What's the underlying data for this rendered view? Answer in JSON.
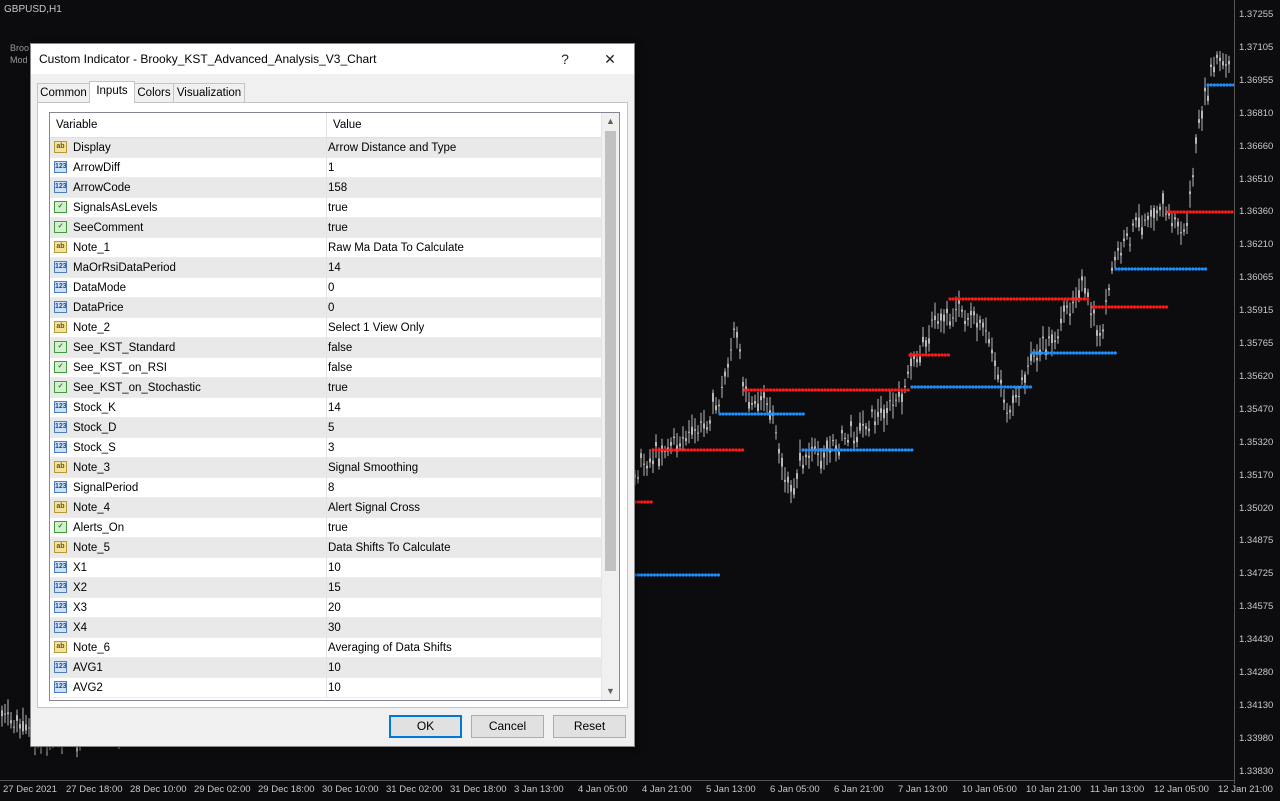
{
  "chart": {
    "title": "GBPUSD,H1",
    "side_lines": [
      "Broo",
      "Mod"
    ],
    "price_labels": [
      "1.37255",
      "1.37105",
      "1.36955",
      "1.36810",
      "1.36660",
      "1.36510",
      "1.36360",
      "1.36210",
      "1.36065",
      "1.35915",
      "1.35765",
      "1.35620",
      "1.35470",
      "1.35320",
      "1.35170",
      "1.35020",
      "1.34875",
      "1.34725",
      "1.34575",
      "1.34430",
      "1.34280",
      "1.34130",
      "1.33980",
      "1.33830"
    ],
    "time_labels": [
      "27 Dec 2021",
      "27 Dec 18:00",
      "28 Dec 10:00",
      "29 Dec 02:00",
      "29 Dec 18:00",
      "30 Dec 10:00",
      "31 Dec 02:00",
      "31 Dec 18:00",
      "3 Jan 13:00",
      "4 Jan 05:00",
      "4 Jan 21:00",
      "5 Jan 13:00",
      "6 Jan 05:00",
      "6 Jan 21:00",
      "7 Jan 13:00",
      "10 Jan 05:00",
      "10 Jan 21:00",
      "11 Jan 13:00",
      "12 Jan 05:00",
      "12 Jan 21:00"
    ],
    "colors": {
      "background": "#0c0c0f",
      "candle": "#b8b8b8",
      "level_up": "#1e90ff",
      "level_down": "#ff1a1a"
    }
  },
  "dialog": {
    "title": "Custom Indicator - Brooky_KST_Advanced_Analysis_V3_Chart",
    "help_label": "?",
    "close_label": "✕",
    "tabs": [
      "Common",
      "Inputs",
      "Colors",
      "Visualization"
    ],
    "active_tab": "Inputs",
    "columns": {
      "variable": "Variable",
      "value": "Value"
    },
    "rows": [
      {
        "icon": "ab",
        "type": "str",
        "name": "Display",
        "value": "Arrow Distance and Type"
      },
      {
        "icon": "123",
        "type": "num",
        "name": "ArrowDiff",
        "value": "1"
      },
      {
        "icon": "123",
        "type": "num",
        "name": "ArrowCode",
        "value": "158"
      },
      {
        "icon": "✓",
        "type": "bool",
        "name": "SignalsAsLevels",
        "value": "true"
      },
      {
        "icon": "✓",
        "type": "bool",
        "name": "SeeComment",
        "value": "true"
      },
      {
        "icon": "ab",
        "type": "str",
        "name": "Note_1",
        "value": "Raw Ma Data To Calculate"
      },
      {
        "icon": "123",
        "type": "num",
        "name": "MaOrRsiDataPeriod",
        "value": "14"
      },
      {
        "icon": "123",
        "type": "num",
        "name": "DataMode",
        "value": "0"
      },
      {
        "icon": "123",
        "type": "num",
        "name": "DataPrice",
        "value": "0"
      },
      {
        "icon": "ab",
        "type": "str",
        "name": "Note_2",
        "value": "Select 1 View Only"
      },
      {
        "icon": "✓",
        "type": "bool",
        "name": "See_KST_Standard",
        "value": "false"
      },
      {
        "icon": "✓",
        "type": "bool",
        "name": "See_KST_on_RSI",
        "value": "false"
      },
      {
        "icon": "✓",
        "type": "bool",
        "name": "See_KST_on_Stochastic",
        "value": "true"
      },
      {
        "icon": "123",
        "type": "num",
        "name": "Stock_K",
        "value": "14"
      },
      {
        "icon": "123",
        "type": "num",
        "name": "Stock_D",
        "value": "5"
      },
      {
        "icon": "123",
        "type": "num",
        "name": "Stock_S",
        "value": "3"
      },
      {
        "icon": "ab",
        "type": "str",
        "name": "Note_3",
        "value": "Signal Smoothing"
      },
      {
        "icon": "123",
        "type": "num",
        "name": "SignalPeriod",
        "value": "8"
      },
      {
        "icon": "ab",
        "type": "str",
        "name": "Note_4",
        "value": "Alert Signal Cross"
      },
      {
        "icon": "✓",
        "type": "bool",
        "name": "Alerts_On",
        "value": "true"
      },
      {
        "icon": "ab",
        "type": "str",
        "name": "Note_5",
        "value": "Data Shifts To Calculate"
      },
      {
        "icon": "123",
        "type": "num",
        "name": "X1",
        "value": "10"
      },
      {
        "icon": "123",
        "type": "num",
        "name": "X2",
        "value": "15"
      },
      {
        "icon": "123",
        "type": "num",
        "name": "X3",
        "value": "20"
      },
      {
        "icon": "123",
        "type": "num",
        "name": "X4",
        "value": "30"
      },
      {
        "icon": "ab",
        "type": "str",
        "name": "Note_6",
        "value": "Averaging of Data Shifts"
      },
      {
        "icon": "123",
        "type": "num",
        "name": "AVG1",
        "value": "10"
      },
      {
        "icon": "123",
        "type": "num",
        "name": "AVG2",
        "value": "10"
      }
    ],
    "buttons": {
      "ok": "OK",
      "cancel": "Cancel",
      "reset": "Reset"
    }
  }
}
